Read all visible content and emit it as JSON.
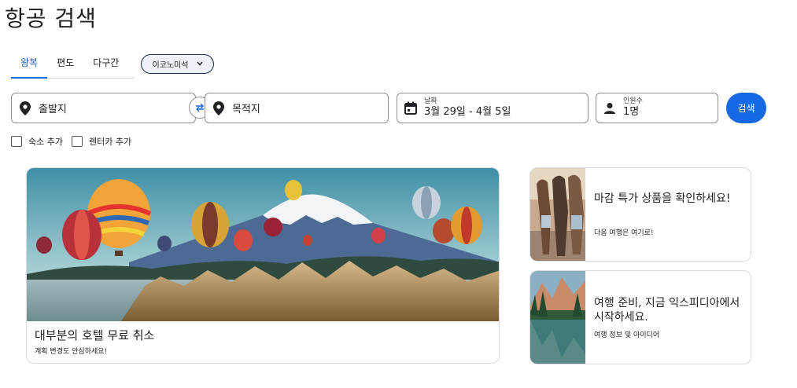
{
  "page": {
    "title": "항공 검색"
  },
  "trip_tabs": [
    {
      "label": "왕복",
      "active": true
    },
    {
      "label": "편도",
      "active": false
    },
    {
      "label": "다구간",
      "active": false
    }
  ],
  "cabin_class": {
    "selected": "이코노미석",
    "icon": "chevron-down-icon"
  },
  "search_form": {
    "origin_placeholder": "출발지",
    "destination_placeholder": "목적지",
    "dates_label": "날짜",
    "dates_value": "3월 29일 - 4월 5일",
    "travelers_label": "인원수",
    "travelers_value": "1명",
    "search_button": "검색"
  },
  "addons": [
    {
      "label": "숙소 추가",
      "checked": false
    },
    {
      "label": "렌터카 추가",
      "checked": false
    }
  ],
  "promos": {
    "hero": {
      "title": "대부분의 호텔 무료 취소",
      "subtitle": "계획 변경도 안심하세요!"
    },
    "cards": [
      {
        "title": "마감 특가 상품을 확인하세요!",
        "subtitle": "다음 여행은 여기로!"
      },
      {
        "title": "여행 준비, 지금 익스피디아에서 시작하세요.",
        "subtitle": "여행 정보 및 아이디어"
      }
    ]
  },
  "colors": {
    "accent": "#1668e3",
    "active_tab": "#1a5fb4",
    "border": "#8a8d93"
  }
}
